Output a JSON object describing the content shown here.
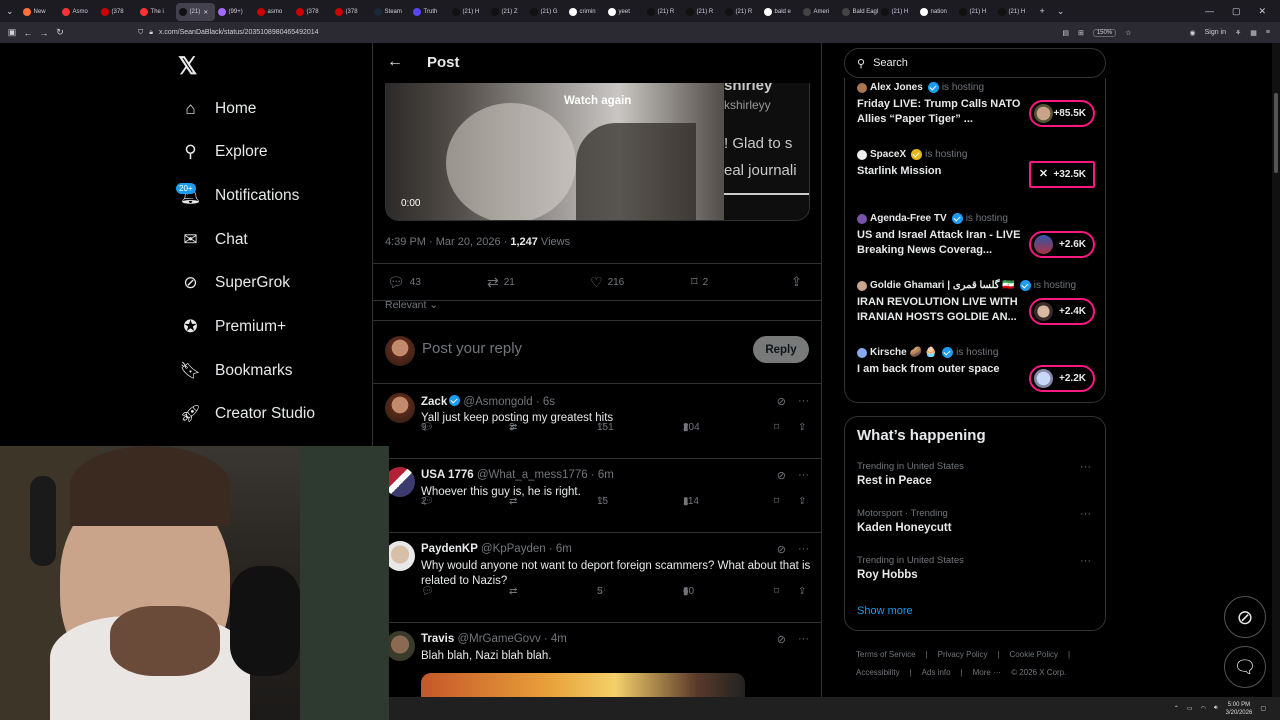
{
  "browser": {
    "tabs": [
      "New",
      "Asmo",
      "(378",
      "The i",
      "(21)",
      "(99+)",
      "asmo",
      "(378",
      "(378",
      "Steam",
      "Truth",
      "(21) H",
      "(21) Z",
      "(21) G",
      "crimin",
      "yeet",
      "(21) R",
      "(21) R",
      "(21) R",
      "bald e",
      "Ameri",
      "Bald Eagle",
      "(21) H",
      "nation",
      "(21) H",
      "(21) H"
    ],
    "tab_colors": [
      "#ff7139",
      "#f33",
      "#c00",
      "#f33",
      "#111",
      "#a26bf7",
      "#c00",
      "#c00",
      "#c00",
      "#1b2838",
      "#5448ee",
      "#111",
      "#111",
      "#111",
      "#fff",
      "#fff",
      "#111",
      "#111",
      "#111",
      "#fff",
      "#444",
      "#444",
      "#111",
      "#fff",
      "#111",
      "#111"
    ],
    "url": "x.com/SeanDaBlack/status/2035108980465492014",
    "zoom": "150%",
    "sign_in": "Sign in"
  },
  "nav": {
    "items": [
      {
        "label": "Home",
        "icon": "home-icon"
      },
      {
        "label": "Explore",
        "icon": "search-icon"
      },
      {
        "label": "Notifications",
        "icon": "bell-icon",
        "badge": "20+"
      },
      {
        "label": "Chat",
        "icon": "mail-icon"
      },
      {
        "label": "SuperGrok",
        "icon": "grok-icon"
      },
      {
        "label": "Premium+",
        "icon": "verified-icon"
      },
      {
        "label": "Bookmarks",
        "icon": "bookmark-icon"
      },
      {
        "label": "Creator Studio",
        "icon": "rocket-icon"
      }
    ]
  },
  "post": {
    "header": "Post",
    "watch_again": "Watch again",
    "video_time": "0:00",
    "video_overlay": [
      "shirley",
      "kshirleyy",
      "! Glad to s",
      "eal journali"
    ],
    "time": "4:39 PM · Mar 20, 2026 · ",
    "views_count": "1,247",
    "views_label": " Views",
    "stats": {
      "replies": "43",
      "reposts": "21",
      "likes": "216",
      "bookmarks": "2"
    },
    "sort": "Relevant",
    "reply_placeholder": "Post your reply",
    "reply_button": "Reply"
  },
  "replies": [
    {
      "name": "Zack",
      "handle": "@Asmongold · 6s",
      "text": "Yall just keep posting my greatest hits",
      "replies": "9",
      "reposts": "3",
      "likes": "151",
      "views": "204",
      "verified": true
    },
    {
      "name": "USA 1776",
      "handle": "@What_a_mess1776 · 6m",
      "text": "Whoever this guy is, he is right.",
      "replies": "2",
      "reposts": "",
      "likes": "15",
      "views": "114",
      "verified": false
    },
    {
      "name": "PaydenKP",
      "handle": "@KpPayden · 6m",
      "text": "Why would anyone not want to deport foreign scammers? What about that is related to Nazis?",
      "replies": "",
      "reposts": "",
      "likes": "5",
      "views": "60",
      "verified": false
    },
    {
      "name": "Travis",
      "handle": "@MrGameGovv · 4m",
      "text": "Blah blah, Nazi blah blah.",
      "verified": false
    }
  ],
  "search": {
    "placeholder": "Search"
  },
  "spaces": [
    {
      "host": "Alex Jones",
      "hosting": "is hosting",
      "title": "Friday LIVE: Trump Calls NATO Allies “Paper Tiger” ...",
      "count": "+85.5K"
    },
    {
      "host": "SpaceX",
      "hosting": "is hosting",
      "title": "Starlink Mission",
      "count": "+32.5K"
    },
    {
      "host": "Agenda-Free TV",
      "hosting": "is hosting",
      "title": "US and Israel Attack Iran - LIVE Breaking News Coverag...",
      "count": "+2.6K"
    },
    {
      "host": "Goldie Ghamari | گلسا قمری 🇮🇷",
      "hosting": "is hosting",
      "title": "IRAN REVOLUTION LIVE WITH IRANIAN HOSTS GOLDIE AN...",
      "count": "+2.4K"
    },
    {
      "host": "Kirsche 🥔 🧁",
      "hosting": "is hosting",
      "title": "I am back from outer space",
      "count": "+2.2K"
    }
  ],
  "happening": {
    "title": "What’s happening",
    "trends": [
      {
        "context": "Trending in United States",
        "name": "Rest in Peace"
      },
      {
        "context": "Motorsport · Trending",
        "name": "Kaden Honeycutt"
      },
      {
        "context": "Trending in United States",
        "name": "Roy Hobbs"
      }
    ],
    "show_more": "Show more"
  },
  "footer": [
    "Terms of Service",
    "|",
    "Privacy Policy",
    "|",
    "Cookie Policy",
    "|",
    "Accessibility",
    "|",
    "Ads info",
    "|",
    "More ···",
    "© 2026 X Corp."
  ],
  "taskbar": {
    "time": "5:00 PM",
    "date": "3/20/2026"
  }
}
